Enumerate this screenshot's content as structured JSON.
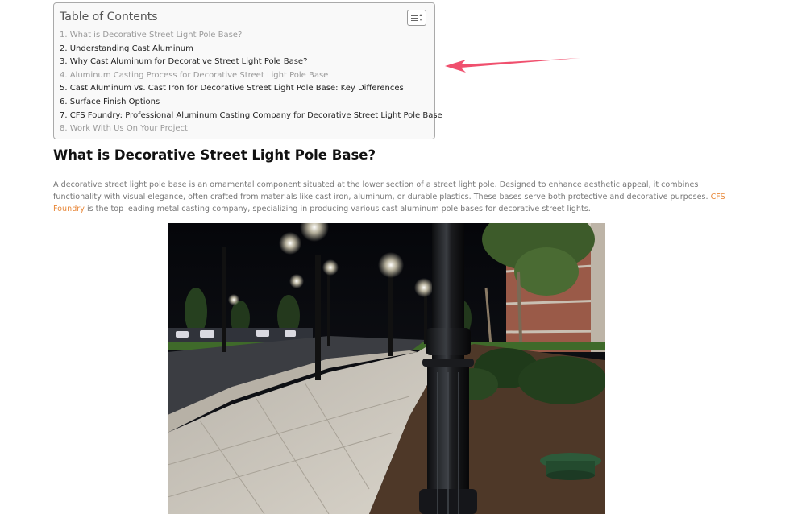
{
  "toc": {
    "title": "Table of Contents",
    "items": [
      {
        "label": "1. What is Decorative Street Light Pole Base?",
        "style": "light"
      },
      {
        "label": "2. Understanding Cast Aluminum",
        "style": "dark"
      },
      {
        "label": "3. Why Cast Aluminum for Decorative Street Light Pole Base?",
        "style": "dark"
      },
      {
        "label": "4. Aluminum Casting Process for Decorative Street Light Pole Base",
        "style": "light"
      },
      {
        "label": "5. Cast Aluminum vs. Cast Iron for Decorative Street Light Pole Base: Key Differences",
        "style": "dark"
      },
      {
        "label": "6. Surface Finish Options",
        "style": "dark"
      },
      {
        "label": "7. CFS Foundry: Professional Aluminum Casting Company for Decorative Street Light Pole Base",
        "style": "dark"
      },
      {
        "label": "8. Work With Us On Your Project",
        "style": "light"
      }
    ]
  },
  "article": {
    "heading": "What is Decorative Street Light Pole Base?",
    "para_before": "A decorative street light pole base is an ornamental component situated at the lower section of a street light pole. Designed to enhance aesthetic appeal, it combines functionality with visual elegance, often crafted from materials like cast iron, aluminum, or durable plastics. These bases serve both protective and decorative purposes. ",
    "link_text": "CFS Foundry",
    "para_after": " is the top leading metal casting company, specializing in producing various cast aluminum pole bases for decorative street lights."
  },
  "colors": {
    "link": "#e8883a",
    "annotation_arrow": "#f0506e"
  },
  "icons": {
    "toc_toggle": "list-toggle-icon",
    "annotation": "red-arrow-icon"
  }
}
